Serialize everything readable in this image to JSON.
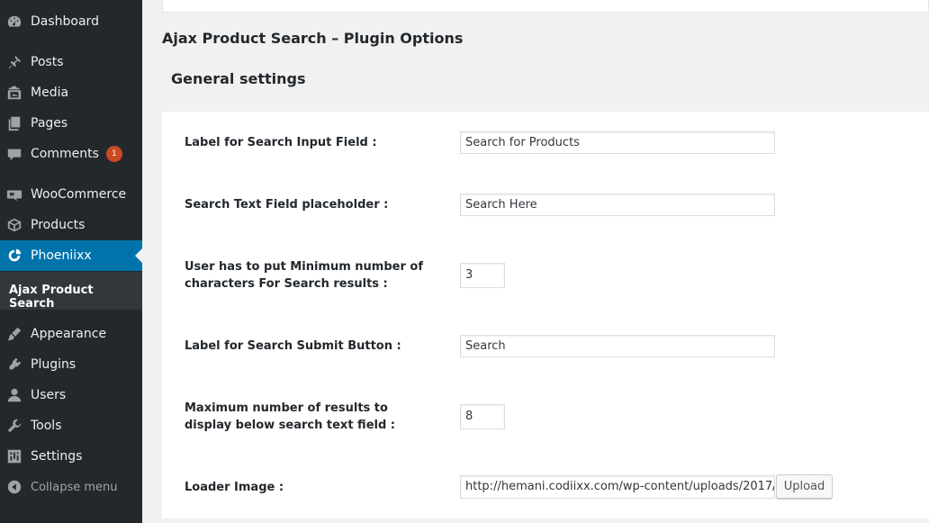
{
  "sidebar": {
    "items": [
      {
        "label": "Dashboard",
        "icon": "dashboard-icon"
      },
      {
        "label": "Posts",
        "icon": "pin-icon"
      },
      {
        "label": "Media",
        "icon": "media-icon"
      },
      {
        "label": "Pages",
        "icon": "pages-icon"
      },
      {
        "label": "Comments",
        "icon": "comment-icon",
        "badge": "1"
      },
      {
        "label": "WooCommerce",
        "icon": "woocommerce-icon"
      },
      {
        "label": "Products",
        "icon": "products-icon"
      },
      {
        "label": "Phoeniixx",
        "icon": "phoeniixx-icon",
        "active": true
      },
      {
        "label": "Appearance",
        "icon": "brush-icon"
      },
      {
        "label": "Plugins",
        "icon": "plugin-icon"
      },
      {
        "label": "Users",
        "icon": "user-icon"
      },
      {
        "label": "Tools",
        "icon": "wrench-icon"
      },
      {
        "label": "Settings",
        "icon": "settings-icon"
      }
    ],
    "submenu_item": "Ajax Product Search",
    "collapse_label": "Collapse menu"
  },
  "main": {
    "page_title": "Ajax Product Search – Plugin Options",
    "section_title": "General settings",
    "fields": [
      {
        "label": "Label for Search Input Field :",
        "value": "Search for Products"
      },
      {
        "label": "Search Text Field placeholder :",
        "value": "Search Here"
      },
      {
        "label": "User has to put Minimum number of characters For Search results :",
        "value": "3"
      },
      {
        "label": "Label for Search Submit Button :",
        "value": "Search"
      },
      {
        "label": "Maximum number of results to display below search text field :",
        "value": "8"
      },
      {
        "label": "Loader Image :",
        "value": "http://hemani.codiixx.com/wp-content/uploads/2017/"
      }
    ],
    "upload_label": "Upload"
  },
  "colors": {
    "sidebar_bg": "#23282d",
    "active_bg": "#0073aa",
    "badge_bg": "#ca4a1f",
    "page_bg": "#f1f1f1"
  }
}
